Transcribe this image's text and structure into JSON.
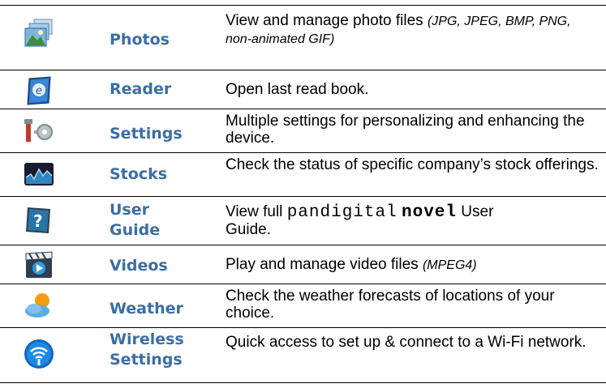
{
  "rows": [
    {
      "name": "Photos",
      "desc": "View and manage photo files ",
      "note": "(JPG, JPEG, BMP, PNG,",
      "note2": "non-animated GIF)",
      "icon": "photos-icon"
    },
    {
      "name": "Reader",
      "desc": "Open last read book.",
      "icon": "reader-icon"
    },
    {
      "name": "Settings",
      "desc": "Multiple settings for personalizing and enhancing the device.",
      "icon": "settings-icon"
    },
    {
      "name": "Stocks",
      "desc": "Check the status of specific company’s stock offerings.",
      "icon": "stocks-icon"
    },
    {
      "name1": "User",
      "name2": "Guide",
      "desc_a": "View full ",
      "brand1": "pandigital",
      "brand2": "novel",
      "desc_b": " User",
      "desc_c": "Guide.",
      "icon": "user-guide-icon"
    },
    {
      "name": "Videos",
      "desc": "Play and manage video files ",
      "note": "(MPEG4)",
      "icon": "videos-icon"
    },
    {
      "name": "Weather",
      "desc": "Check the weather forecasts of locations of your choice.",
      "icon": "weather-icon"
    },
    {
      "name1": "Wireless",
      "name2": "Settings",
      "desc": "Quick access to set up & connect to a Wi-Fi network.",
      "icon": "wifi-icon"
    }
  ]
}
